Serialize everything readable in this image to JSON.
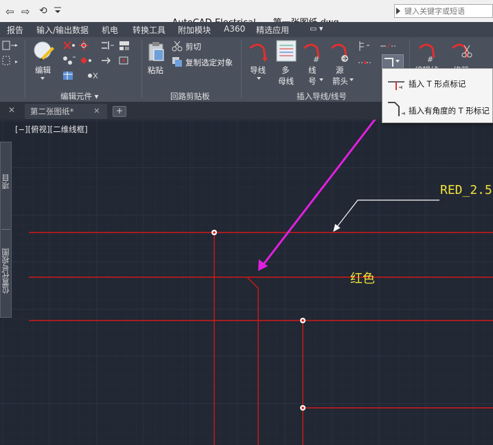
{
  "window": {
    "app_title": "AutoCAD Electrical",
    "file_title": "第一张图纸.dwg",
    "search_placeholder": "键入关键字或短语"
  },
  "menu_tabs": [
    "报告",
    "输入/输出数据",
    "机电",
    "转换工具",
    "附加模块",
    "A360",
    "精选应用",
    "▭ ▾"
  ],
  "ribbon": {
    "edit_label": "编辑",
    "paste_label": "粘贴",
    "cut_label": "剪切",
    "copy_select_label": "复制选定对象",
    "wire_label": "导线",
    "multi_bus_label": [
      "多",
      "母线"
    ],
    "wire_number_label": [
      "线",
      "号"
    ],
    "source_arrow_label": [
      "源",
      "箭头"
    ],
    "edit_wire_label": "编辑线",
    "trim_label": "修剪",
    "panel_edit_components": "编辑元件 ▾",
    "panel_circuit_clipboard": "回路剪贴板",
    "panel_insert_wires": "插入导线/线号"
  },
  "flyout": {
    "item1": "插入 T 形点标记",
    "item2": "插入有角度的 T 形标记"
  },
  "doc_tabs": [
    "第二张图纸*"
  ],
  "canvas": {
    "viewport_label": "[−][俯视][二维线框]",
    "leader_text": "RED_2.5",
    "wire_color_text": "红色"
  },
  "side_palette": {
    "project_label": "项目",
    "location_label": "位置代号视图"
  },
  "colors": {
    "wire": "#d11a1a",
    "annotation_text": "#f2e23a",
    "callout_arrow": "#e020e0",
    "grid": "#2c3341",
    "ribbon": "#4a505c"
  }
}
